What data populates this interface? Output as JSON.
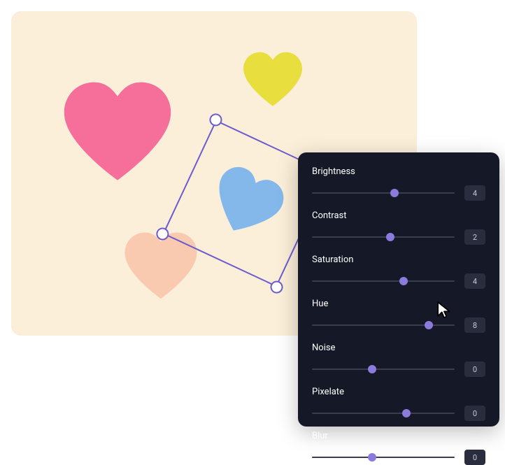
{
  "canvas": {
    "hearts": {
      "pink_color": "#F56F9A",
      "yellow_color": "#E8DE3E",
      "peach_color": "#F9C9B0",
      "blue_color": "#84B8EB"
    },
    "selection": {
      "border_color": "#6C5BCE"
    }
  },
  "panel": {
    "sliders": [
      {
        "label": "Brightness",
        "value": "4",
        "percent": 58
      },
      {
        "label": "Contrast",
        "value": "2",
        "percent": 55
      },
      {
        "label": "Saturation",
        "value": "4",
        "percent": 64
      },
      {
        "label": "Hue",
        "value": "8",
        "percent": 82
      },
      {
        "label": "Noise",
        "value": "0",
        "percent": 42
      },
      {
        "label": "Pixelate",
        "value": "0",
        "percent": 66
      },
      {
        "label": "Blur",
        "value": "0",
        "percent": 42
      }
    ]
  }
}
